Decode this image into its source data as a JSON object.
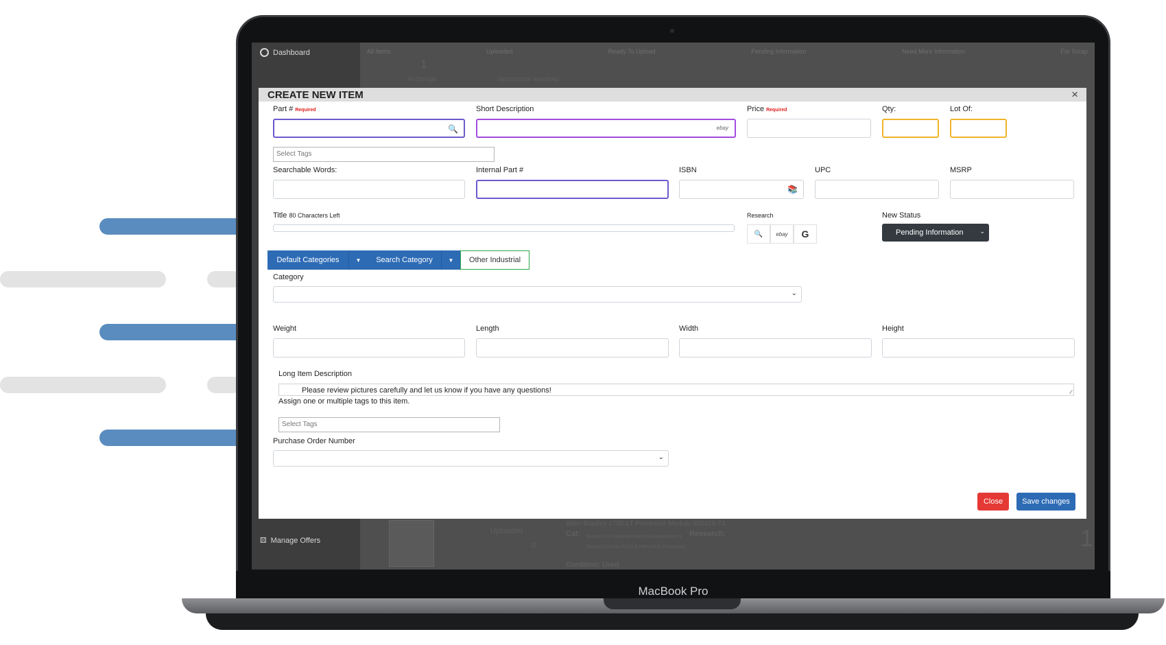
{
  "device": {
    "brand": "MacBook Pro"
  },
  "background_app": {
    "sidebar": {
      "dashboard": "Dashboard",
      "manage_offers": "Manage Offers"
    },
    "tabs": [
      "All Items",
      "Uploaded",
      "Ready To Upload",
      "Pending Information",
      "Need More Information",
      "For Scrap"
    ],
    "storage_count": "1",
    "storage_label": "In Storage",
    "sync_label": "Synchronize Inventory",
    "listing_title": "Allen-Bradley 1785-LT Processor Module 960418-74",
    "listing_status": "Uploaded",
    "listing_cat_label": "Cat:",
    "listing_cat_value": "Business & Industrial:Industrial Automation & Motion Controls:PLCs & HMIs:PLC Processors",
    "listing_research": "Research:",
    "listing_condition": "Condition: Used",
    "listing_qty": "1",
    "listing_photo_count": "0"
  },
  "modal": {
    "title": "CREATE NEW ITEM",
    "close_glyph": "×",
    "required": "Required",
    "part_label": "Part #",
    "short_desc_label": "Short Description",
    "ebay_tag": "ebay",
    "price_label": "Price",
    "qty_label": "Qty:",
    "lot_label": "Lot Of:",
    "select_tags": "Select Tags",
    "searchable_label": "Searchable Words:",
    "internal_part_label": "Internal Part #",
    "isbn_label": "ISBN",
    "upc_label": "UPC",
    "msrp_label": "MSRP",
    "title_label": "Title",
    "title_counter": "80 Characters Left",
    "research_label": "Research",
    "research_ebay": "ebay",
    "research_google": "G",
    "new_status_label": "New Status",
    "status_value": "Pending Information",
    "default_categories": "Default Categories",
    "search_category": "Search Category",
    "other_industrial": "Other Industrial",
    "category_label": "Category",
    "weight_label": "Weight",
    "length_label": "Length",
    "width_label": "Width",
    "height_label": "Height",
    "long_desc_label": "Long Item Description",
    "long_desc_value": "Please review pictures carefully and let us know if you have any questions!",
    "assign_tags_text": "Assign one or multiple tags to this item.",
    "po_label": "Purchase Order Number",
    "btn_close": "Close",
    "btn_save": "Save changes"
  }
}
